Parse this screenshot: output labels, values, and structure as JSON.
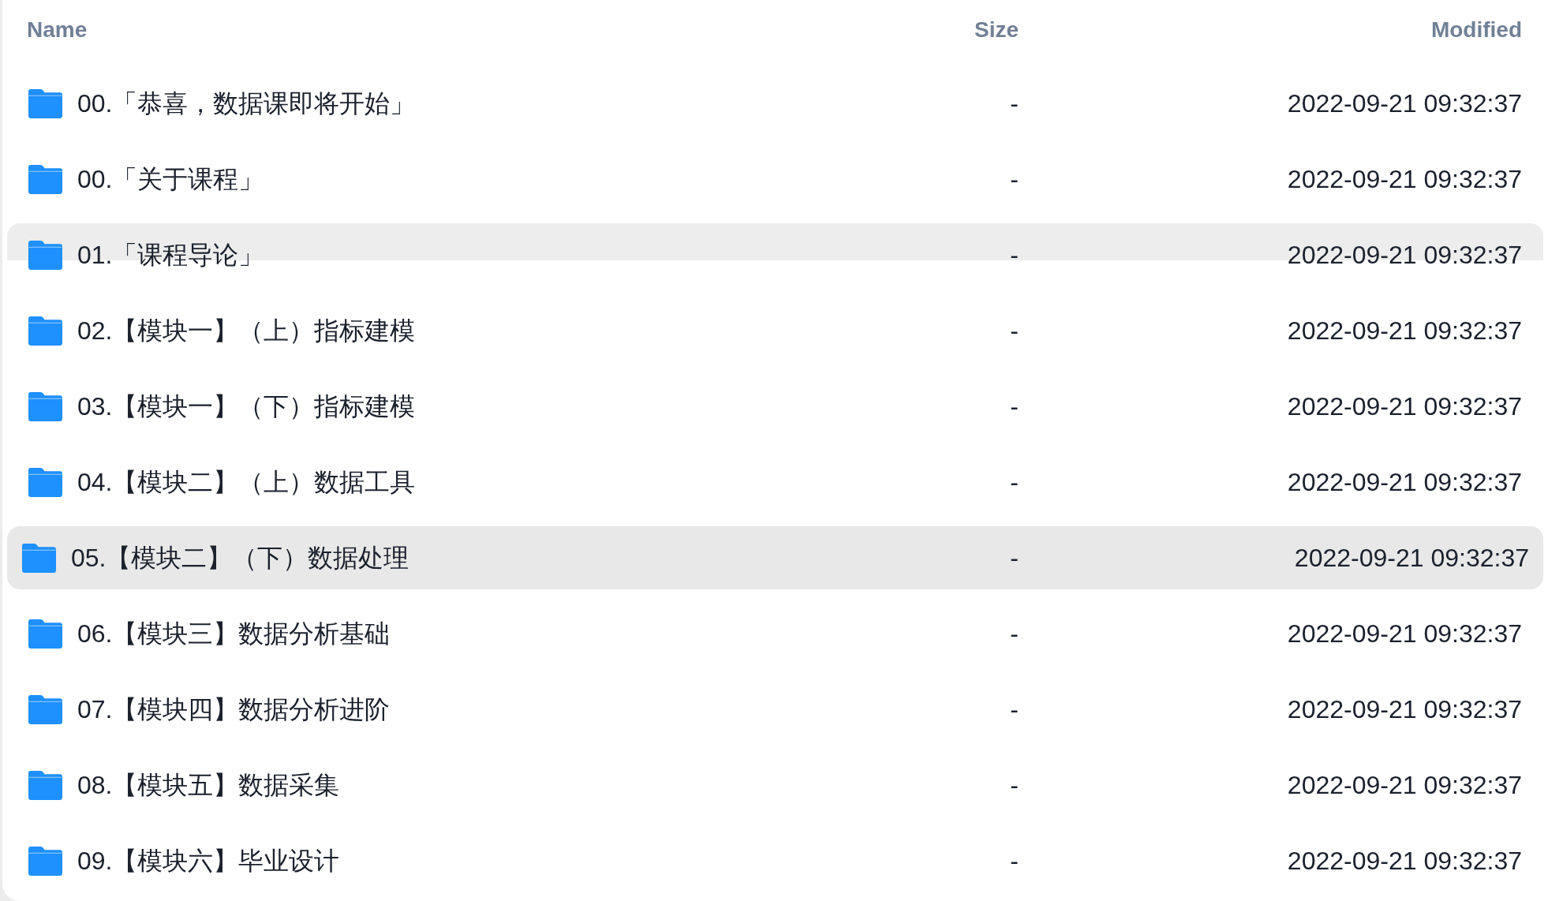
{
  "columns": [
    {
      "label": "Name"
    },
    {
      "label": "Size"
    },
    {
      "label": "Modified"
    }
  ],
  "rows": [
    {
      "name": "00.「恭喜，数据课即将开始」",
      "size": "-",
      "modified": "2022-09-21 09:32:37",
      "selected": false,
      "dragging": false
    },
    {
      "name": "00.「关于课程」",
      "size": "-",
      "modified": "2022-09-21 09:32:37",
      "selected": false,
      "dragging": false
    },
    {
      "name": "01.「课程导论」",
      "size": "-",
      "modified": "2022-09-21 09:32:37",
      "selected": false,
      "dragging": true
    },
    {
      "name": "02.【模块一】（上）指标建模",
      "size": "-",
      "modified": "2022-09-21 09:32:37",
      "selected": false,
      "dragging": false
    },
    {
      "name": "03.【模块一】（下）指标建模",
      "size": "-",
      "modified": "2022-09-21 09:32:37",
      "selected": false,
      "dragging": false
    },
    {
      "name": "04.【模块二】（上）数据工具",
      "size": "-",
      "modified": "2022-09-21 09:32:37",
      "selected": false,
      "dragging": false
    },
    {
      "name": "05.【模块二】（下）数据处理",
      "size": "-",
      "modified": "2022-09-21 09:32:37",
      "selected": true,
      "dragging": false
    },
    {
      "name": "06.【模块三】数据分析基础",
      "size": "-",
      "modified": "2022-09-21 09:32:37",
      "selected": false,
      "dragging": false
    },
    {
      "name": "07.【模块四】数据分析进阶",
      "size": "-",
      "modified": "2022-09-21 09:32:37",
      "selected": false,
      "dragging": false
    },
    {
      "name": "08.【模块五】数据采集",
      "size": "-",
      "modified": "2022-09-21 09:32:37",
      "selected": false,
      "dragging": false
    },
    {
      "name": "09.【模块六】毕业设计",
      "size": "-",
      "modified": "2022-09-21 09:32:37",
      "selected": false,
      "dragging": false
    }
  ]
}
